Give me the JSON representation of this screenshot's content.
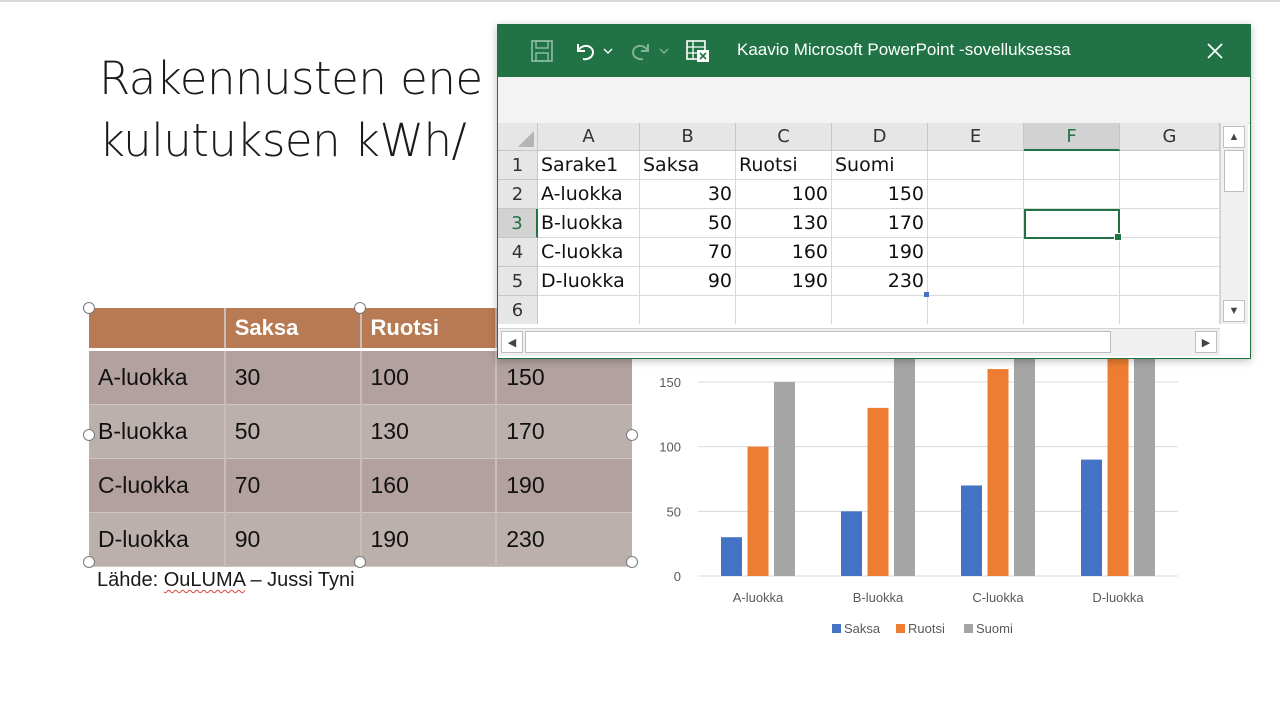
{
  "slide": {
    "title_line1": "Rakennusten ene",
    "title_line2": "kulutuksen kWh/",
    "source_prefix": "Lähde: ",
    "source_name": "OuLUMA",
    "source_suffix": " – Jussi Tyni"
  },
  "slide_table": {
    "headers": [
      "",
      "Saksa",
      "Ruotsi",
      ""
    ],
    "rows": [
      [
        "A-luokka",
        "30",
        "100",
        "150"
      ],
      [
        "B-luokka",
        "50",
        "130",
        "170"
      ],
      [
        "C-luokka",
        "70",
        "160",
        "190"
      ],
      [
        "D-luokka",
        "90",
        "190",
        "230"
      ]
    ]
  },
  "excel": {
    "window_title": "Kaavio Microsoft PowerPoint -sovelluksessa",
    "colors": {
      "titlebar": "#217346",
      "selection": "#217346"
    },
    "icons": [
      "save-icon",
      "undo-icon",
      "redo-icon",
      "edit-data-icon",
      "close-icon"
    ],
    "columns": [
      "A",
      "B",
      "C",
      "D",
      "E",
      "F",
      "G"
    ],
    "row_numbers": [
      "1",
      "2",
      "3",
      "4",
      "5",
      "6"
    ],
    "selected_column": "F",
    "selected_row": "3",
    "cells": [
      [
        "Sarake1",
        "Saksa",
        "Ruotsi",
        "Suomi",
        "",
        "",
        ""
      ],
      [
        "A-luokka",
        "30",
        "100",
        "150",
        "",
        "",
        ""
      ],
      [
        "B-luokka",
        "50",
        "130",
        "170",
        "",
        "",
        ""
      ],
      [
        "C-luokka",
        "70",
        "160",
        "190",
        "",
        "",
        ""
      ],
      [
        "D-luokka",
        "90",
        "190",
        "230",
        "",
        "",
        ""
      ],
      [
        "",
        "",
        "",
        "",
        "",
        "",
        ""
      ]
    ]
  },
  "chart_data": {
    "type": "bar",
    "categories": [
      "A-luokka",
      "B-luokka",
      "C-luokka",
      "D-luokka"
    ],
    "series": [
      {
        "name": "Saksa",
        "values": [
          30,
          50,
          70,
          90
        ],
        "color": "#4472c4"
      },
      {
        "name": "Ruotsi",
        "values": [
          100,
          130,
          160,
          190
        ],
        "color": "#ed7d31"
      },
      {
        "name": "Suomi",
        "values": [
          150,
          170,
          190,
          230
        ],
        "color": "#a5a5a5"
      }
    ],
    "y_ticks": [
      "0",
      "50",
      "100",
      "150"
    ],
    "ylim": [
      0,
      150
    ],
    "grid": true,
    "legend": "bottom",
    "title": "",
    "xlabel": "",
    "ylabel": ""
  }
}
